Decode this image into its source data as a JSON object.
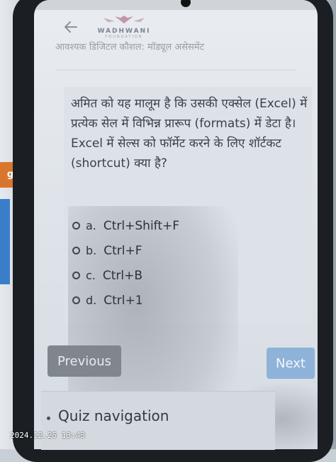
{
  "header": {
    "logo_name": "WADHWANI",
    "logo_sub": "FOUNDATION",
    "course_title": "आवश्यक डिजिटल कौशल: मॉड्यूल असेसमेंट"
  },
  "question": {
    "text": "अमित को यह मालूम है कि उसकी एक्सेल (Excel) में प्रत्येक सेल में विभिन्न प्रारूप (formats) में डेटा है। Excel में सेल्स को फॉर्मेट करने के लिए शॉर्टकट (shortcut) क्या है?"
  },
  "options": [
    {
      "letter": "a.",
      "text": "Ctrl+Shift+F"
    },
    {
      "letter": "b.",
      "text": "Ctrl+F"
    },
    {
      "letter": "c.",
      "text": "Ctrl+B"
    },
    {
      "letter": "d.",
      "text": "Ctrl+1"
    }
  ],
  "buttons": {
    "previous": "Previous",
    "next": "Next"
  },
  "quiz_nav": {
    "label": "Quiz navigation"
  },
  "photo": {
    "timestamp": "2024.12.25 13:43"
  },
  "colors": {
    "next_button": "#8fb2d9",
    "previous_button": "#7f868d",
    "text": "#2a3036"
  }
}
